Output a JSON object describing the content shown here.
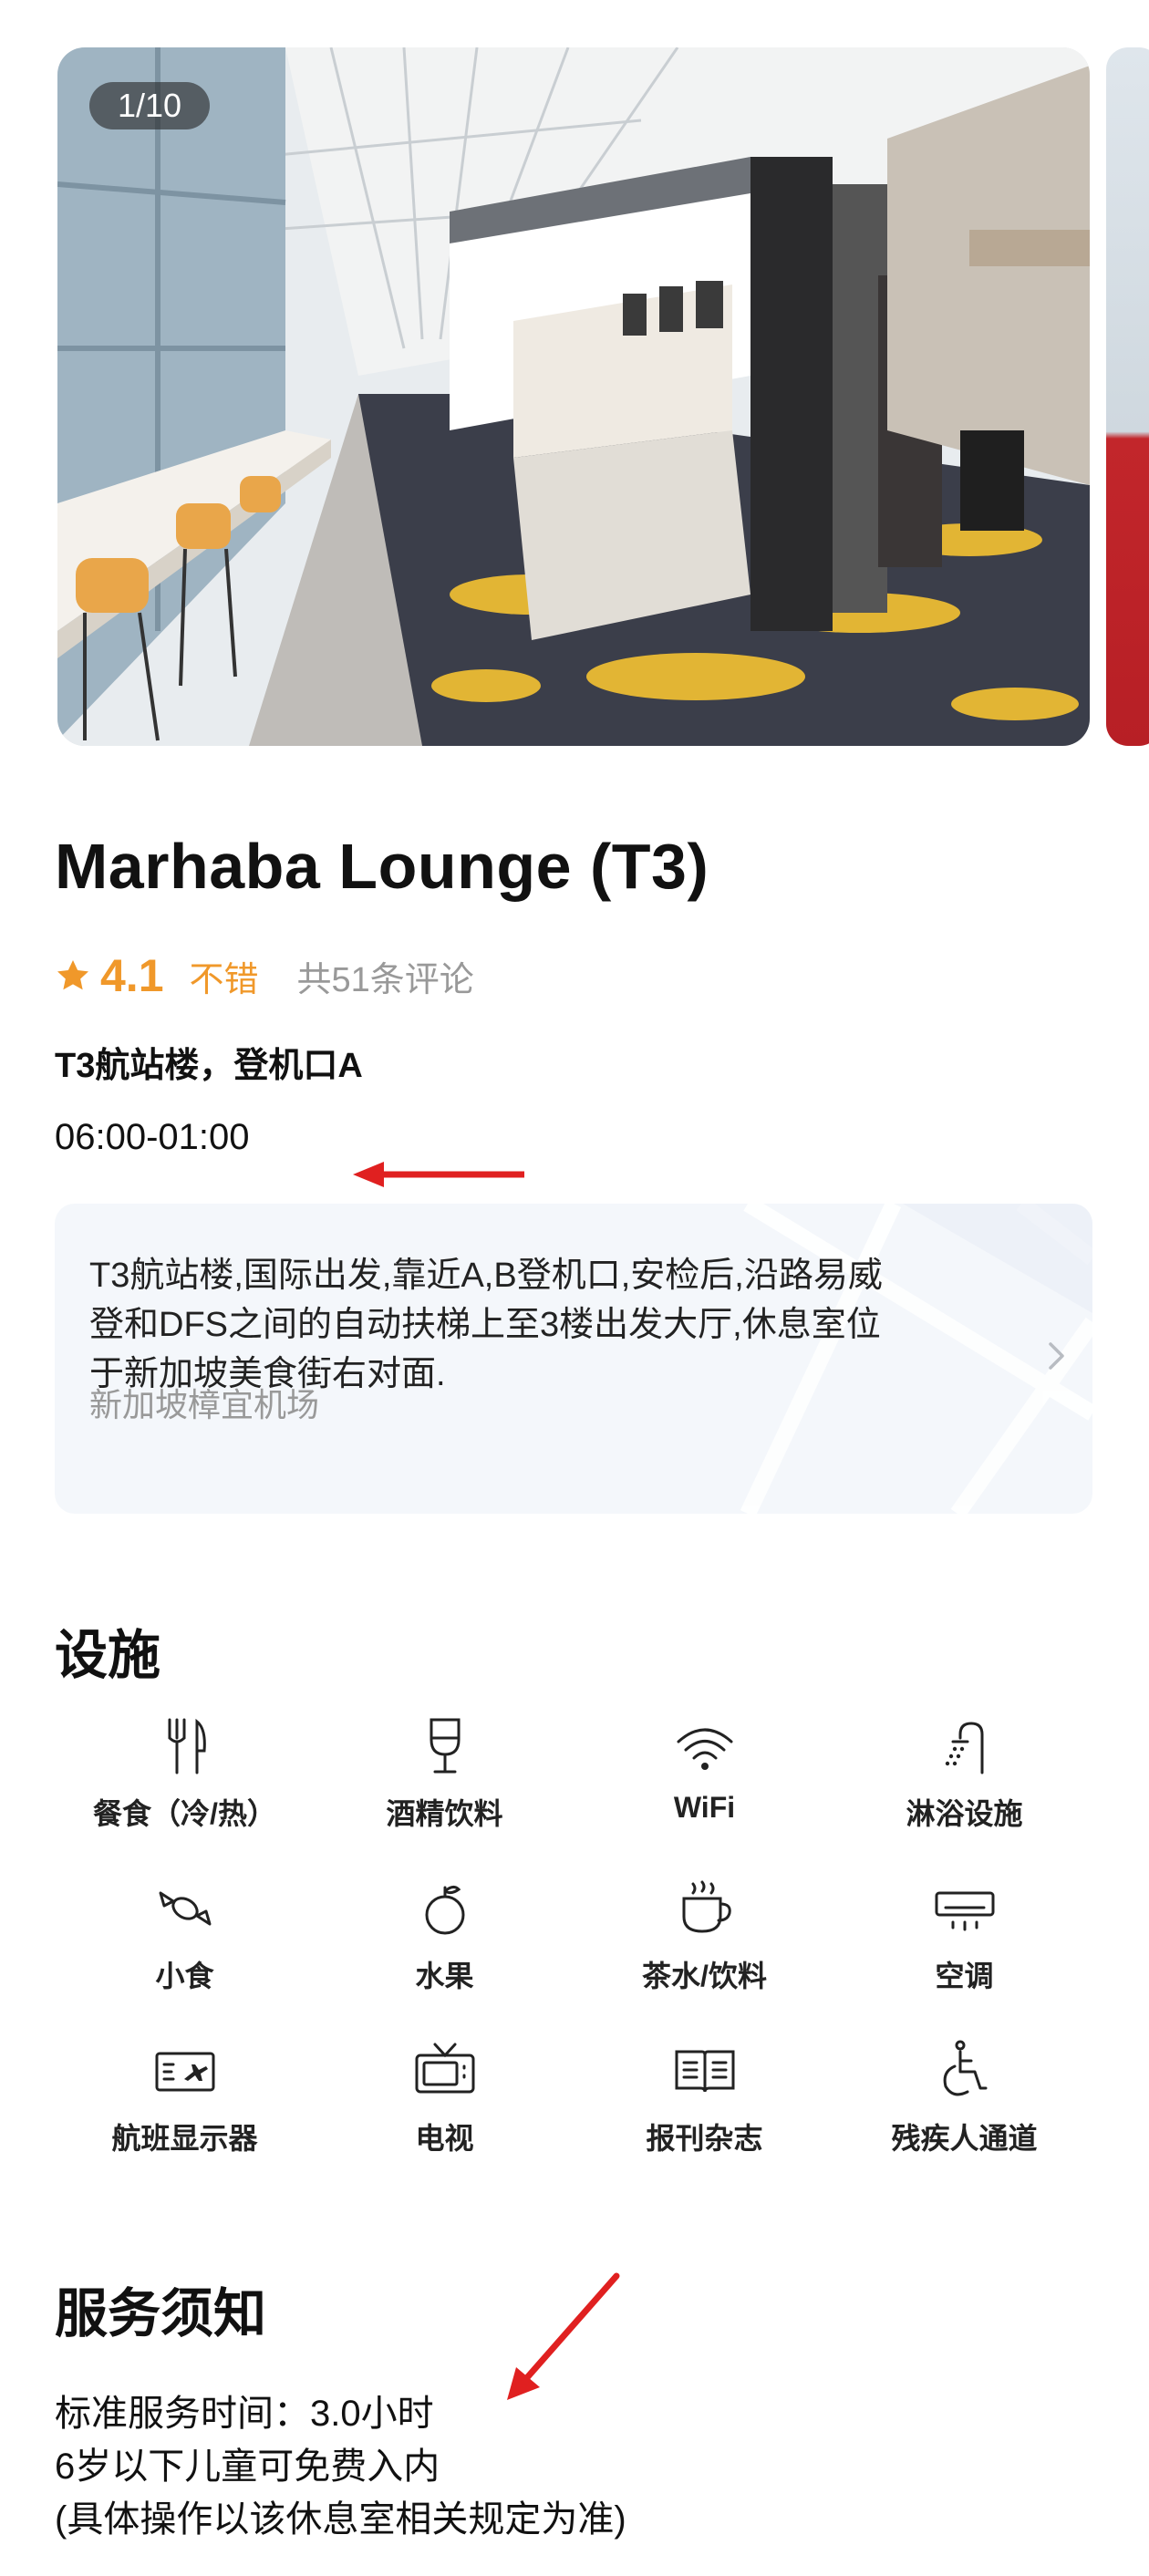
{
  "gallery": {
    "counter": "1/10"
  },
  "lounge": {
    "name": "Marhaba Lounge (T3)",
    "rating": "4.1",
    "rating_label": "不错",
    "review_count": "共51条评论",
    "location": "T3航站楼，登机口A",
    "hours": "06:00-01:00"
  },
  "directions": {
    "line1": "T3航站楼,国际出发,靠近A,B登机口,安检后,沿路易威",
    "line2": "登和DFS之间的自动扶梯上至3楼出发大厅,休息室位",
    "line3": "于新加坡美食街右对面.",
    "airport": "新加坡樟宜机场"
  },
  "facilities": {
    "title": "设施",
    "items": [
      {
        "label": "餐食（冷/热）",
        "icon": "utensils-icon"
      },
      {
        "label": "酒精饮料",
        "icon": "wine-glass-icon"
      },
      {
        "label": "WiFi",
        "icon": "wifi-icon"
      },
      {
        "label": "淋浴设施",
        "icon": "shower-icon"
      },
      {
        "label": "小食",
        "icon": "candy-icon"
      },
      {
        "label": "水果",
        "icon": "fruit-icon"
      },
      {
        "label": "茶水/饮料",
        "icon": "cup-icon"
      },
      {
        "label": "空调",
        "icon": "air-conditioner-icon"
      },
      {
        "label": "航班显示器",
        "icon": "flight-display-icon"
      },
      {
        "label": "电视",
        "icon": "tv-icon"
      },
      {
        "label": "报刊杂志",
        "icon": "newspaper-icon"
      },
      {
        "label": "残疾人通道",
        "icon": "accessibility-icon"
      }
    ]
  },
  "service": {
    "title": "服务须知",
    "line1": "标准服务时间：3.0小时",
    "line2": "6岁以下儿童可免费入内",
    "line3": "(具体操作以该休息室相关规定为准)"
  },
  "colors": {
    "accent_orange": "#f0982a",
    "annotation_red": "#e02020",
    "card_bg": "#f4f7fb"
  }
}
